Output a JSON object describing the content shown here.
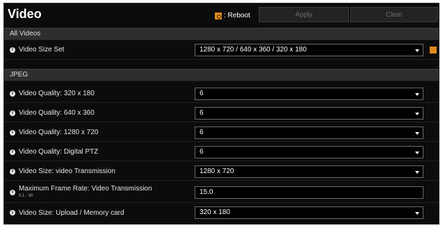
{
  "header": {
    "title": "Video",
    "reboot_label": ": Reboot",
    "apply_label": "Apply",
    "clear_label": "Clear"
  },
  "all_videos": {
    "section_label": "All Videos",
    "video_size_set": {
      "label": "Video Size Set",
      "value": "1280 x 720 / 640 x 360 / 320 x 180"
    }
  },
  "jpeg": {
    "section_label": "JPEG",
    "rows": [
      {
        "label": "Video Quality: 320 x 180",
        "value": "6"
      },
      {
        "label": "Video Quality: 640 x 360",
        "value": "6"
      },
      {
        "label": "Video Quality: 1280 x 720",
        "value": "6"
      },
      {
        "label": "Video Quality: Digital PTZ",
        "value": "6"
      },
      {
        "label": "Video Size: video Transmission",
        "value": "1280 x 720"
      }
    ],
    "max_frame_rate": {
      "label": "Maximum Frame Rate: Video Transmission",
      "hint": "0.1 - 30",
      "value": "15.0"
    },
    "upload_size": {
      "label": "Video Size: Upload / Memory card",
      "value": "320 x 180"
    }
  },
  "icons": {
    "reboot": "reboot-icon",
    "info": "info-icon",
    "dropdown": "chevron-down-icon"
  },
  "colors": {
    "background": "#0c0c0c",
    "section": "#2e2e2e",
    "accent": "#e08a1e"
  }
}
